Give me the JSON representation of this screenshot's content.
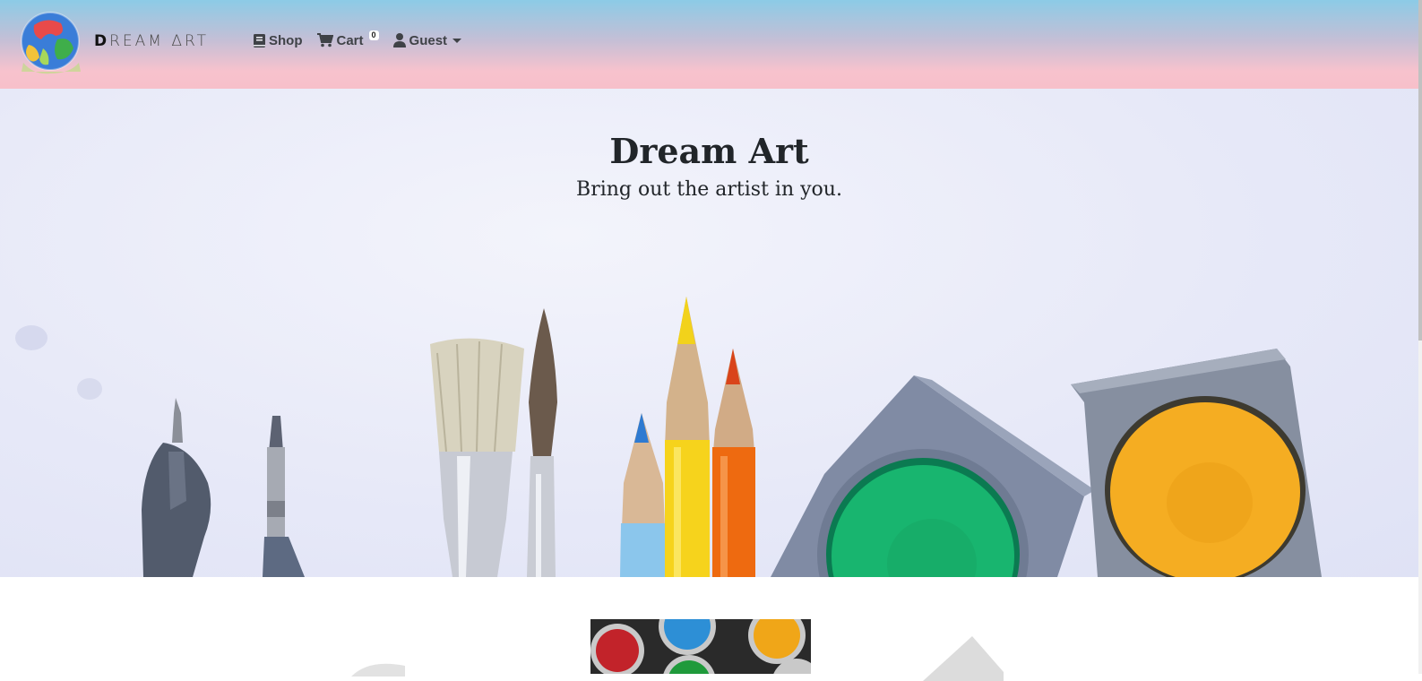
{
  "header": {
    "brand_first": "D",
    "brand_rest": "REAM ΔRT",
    "nav": {
      "shop_label": "Shop",
      "cart_label": "Cart",
      "cart_count": "0",
      "user_label": "Guest"
    }
  },
  "hero": {
    "title": "Dream Art",
    "subtitle": "Bring out the artist in you."
  },
  "icons": {
    "shop": "book-icon",
    "cart": "shopping-cart-icon",
    "user": "user-icon",
    "dropdown": "caret-down-icon"
  },
  "colors": {
    "navbar_top": "#8ccbe6",
    "navbar_bottom": "#f7c0ca",
    "hero_bg": "#e7e9f8",
    "text_dark": "#212529"
  }
}
